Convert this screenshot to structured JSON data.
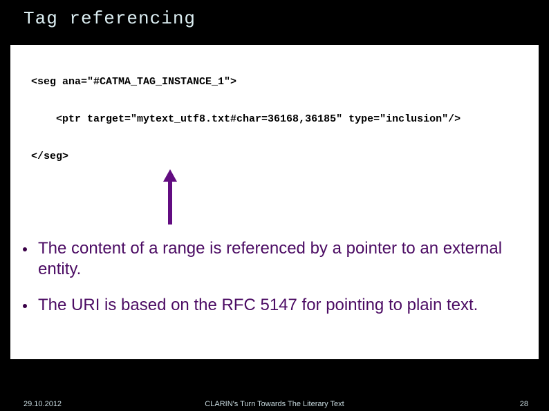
{
  "slide": {
    "title": "Tag referencing"
  },
  "code": {
    "line1": "<seg ana=\"#CATMA_TAG_INSTANCE_1\">",
    "line2": "    <ptr target=\"mytext_utf8.txt#char=36168,36185\" type=\"inclusion\"/>",
    "line3": "</seg>"
  },
  "bullets": {
    "item1": "The content of a range is referenced by a pointer to an external entity.",
    "item2": "The URI is based on the RFC 5147 for pointing to plain text."
  },
  "footer": {
    "date": "29.10.2012",
    "center": "CLARIN's Turn Towards The Literary Text",
    "page": "28"
  }
}
